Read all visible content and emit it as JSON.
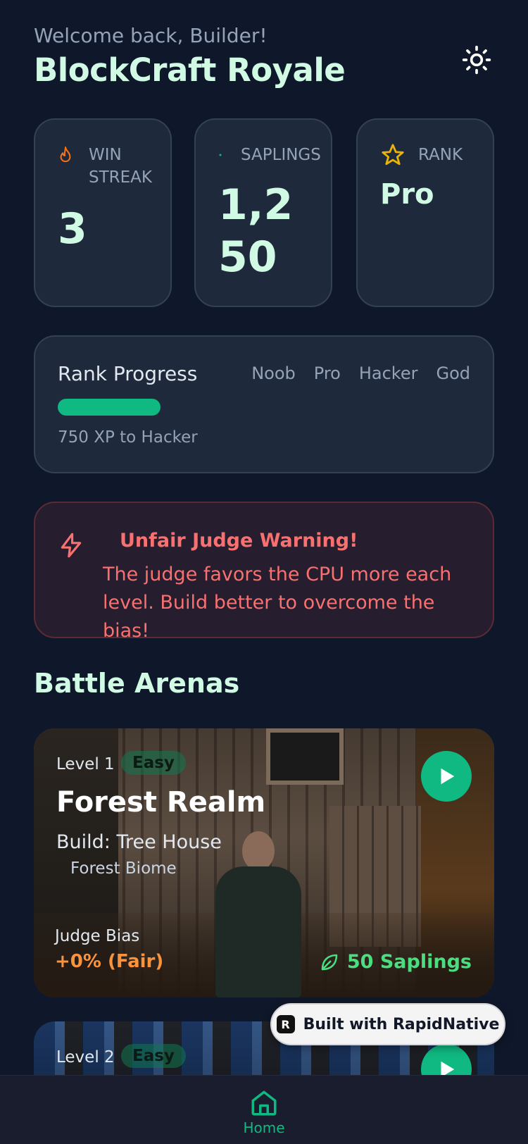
{
  "header": {
    "welcome": "Welcome back, Builder!",
    "title": "BlockCraft Royale",
    "theme_icon": "sun-icon"
  },
  "stats": [
    {
      "label": "WIN STREAK",
      "value": "3",
      "icon": "flame-icon",
      "icon_color": "#f97316"
    },
    {
      "label": "SAPLINGS",
      "value": "1,250",
      "icon": "sapling-icon",
      "icon_color": "#10b981"
    },
    {
      "label": "RANK",
      "value": "Pro",
      "icon": "star-icon",
      "icon_color": "#eab308"
    }
  ],
  "rank_progress": {
    "title": "Rank Progress",
    "tiers": [
      "Noob",
      "Pro",
      "Hacker",
      "God"
    ],
    "subtitle": "750 XP to Hacker",
    "bar_color": "#10b981"
  },
  "warning": {
    "icon": "lightning-icon",
    "title": "Unfair Judge Warning!",
    "text": "The judge favors the CPU more each level. Build better to overcome the bias!"
  },
  "section": {
    "title": "Battle Arenas"
  },
  "arenas": [
    {
      "level": "Level 1",
      "difficulty": "Easy",
      "title": "Forest Realm",
      "build": "Build: Tree House",
      "biome": "Forest Biome",
      "bias_label": "Judge Bias",
      "bias_value": "+0% (Fair)",
      "reward": "50 Saplings"
    },
    {
      "level": "Level 2",
      "difficulty": "Easy"
    }
  ],
  "badge": {
    "text": "Built with RapidNative"
  },
  "tabbar": {
    "home_label": "Home"
  },
  "colors": {
    "background": "#0f172a",
    "accent": "#10b981",
    "warning": "#f87171",
    "bias": "#fb923c"
  }
}
